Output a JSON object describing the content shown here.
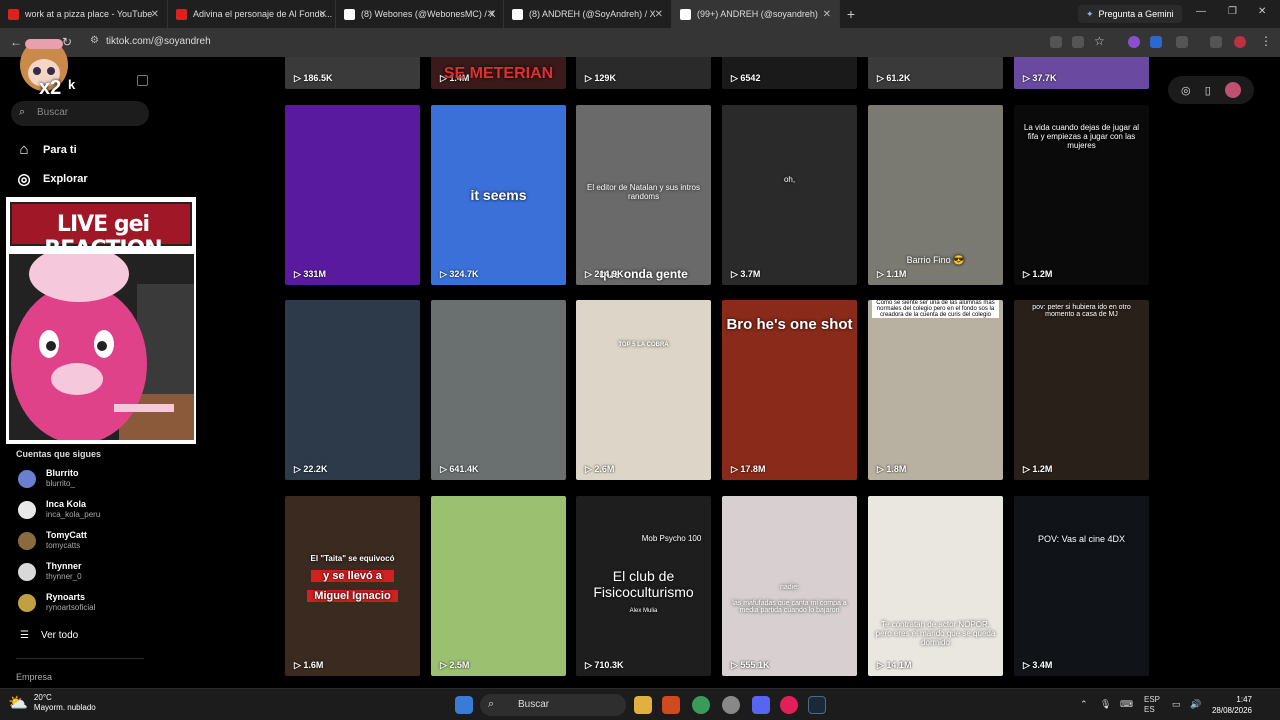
{
  "browser": {
    "tabs": [
      {
        "title": "work at a pizza place - YouTube",
        "icon": "youtube-icon",
        "color": "#e02020"
      },
      {
        "title": "Adivina el personaje de Al Fondo...",
        "icon": "youtube-icon",
        "color": "#e02020"
      },
      {
        "title": "(8) Webones (@WebonesMC) / X",
        "icon": "x-icon",
        "color": "#ffffff"
      },
      {
        "title": "(8) ANDREH (@SoyAndreh) / X",
        "icon": "x-icon",
        "color": "#ffffff"
      },
      {
        "title": "(99+) ANDREH (@soyandreh)",
        "icon": "tiktok-icon",
        "color": "#ffffff"
      }
    ],
    "gemini_label": "Pregunta a Gemini",
    "url": "tiktok.com/@soyandreh"
  },
  "sidebar": {
    "logo_text": "k",
    "search_placeholder": "Buscar",
    "nav": [
      {
        "label": "Para ti",
        "icon": "home-icon"
      },
      {
        "label": "Explorar",
        "icon": "compass-icon"
      }
    ],
    "overlay": {
      "label": "x2"
    },
    "live_banner": "LIVE gei REACTION",
    "following_title": "Cuentas que sigues",
    "accounts": [
      {
        "name": "Blurrito",
        "handle": "blurrito_",
        "color": "#6a7fd0"
      },
      {
        "name": "Inca Kola",
        "handle": "inca_kola_peru",
        "color": "#e8e8e8"
      },
      {
        "name": "TomyCatt",
        "handle": "tomycatts",
        "color": "#8a6b3d"
      },
      {
        "name": "Thynner",
        "handle": "thynner_0",
        "color": "#d8d8d8"
      },
      {
        "name": "Rynoarts",
        "handle": "rynoartsoficial",
        "color": "#c0a040"
      }
    ],
    "see_all": "Ver todo",
    "company": "Empresa"
  },
  "videos": {
    "top_row": [
      "186.5K",
      "1.4M",
      "129K",
      "6542",
      "61.2K",
      "37.7K"
    ],
    "top_row_caption": "SE METERIAN",
    "rows": [
      [
        {
          "views": "331M",
          "caption": "",
          "bg": "#5a1aa0"
        },
        {
          "views": "324.7K",
          "caption": "it seems",
          "bg": "#3a70d8"
        },
        {
          "views": "214.9K",
          "caption": "El editor de Natalan y sus intros randoms",
          "caption2": "que onda gente",
          "bg": "#6a6a6a"
        },
        {
          "views": "3.7M",
          "caption": "oh,",
          "bg": "#2a2a2a"
        },
        {
          "views": "1.1M",
          "caption": "Barrio Fino 😎",
          "bg": "#7a7a72"
        },
        {
          "views": "1.2M",
          "caption": "La vida cuando dejas de jugar al fifa y empiezas a jugar con las mujeres",
          "bg": "#0a0a0a"
        }
      ],
      [
        {
          "views": "22.2K",
          "caption": "",
          "bg": "#2c3a4a"
        },
        {
          "views": "641.4K",
          "caption": "",
          "bg": "#6a7070"
        },
        {
          "views": "2.6M",
          "caption": "TOP 5 LA COBRA",
          "bg": "#ddd6c8"
        },
        {
          "views": "17.8M",
          "caption": "Bro he's one shot",
          "bg": "#8a2a1a"
        },
        {
          "views": "1.8M",
          "caption": "Como se siente ser una de las alumnas mas normales del colegio pero en el fondo sos la creadora de la cuenta de curis del colegio",
          "bg": "#b8b0a0"
        },
        {
          "views": "1.2M",
          "caption": "pov: peter si hubiera ido en otro momento a casa de MJ",
          "bg": "#2a201a"
        }
      ],
      [
        {
          "views": "1.6M",
          "caption": "El \"Taita\" se equivocó",
          "caption2": "y se llevó a",
          "caption3": "Miguel Ignacio",
          "bg": "#3a2a20"
        },
        {
          "views": "2.5M",
          "caption": "",
          "bg": "#9ac070"
        },
        {
          "views": "710.3K",
          "caption": "El club de Fisicoculturismo",
          "caption2": "Mob Psycho 100",
          "caption3": "Alex Mulia",
          "bg": "#1e1e1e"
        },
        {
          "views": "555.1K",
          "caption": "nadie:",
          "caption2": "las mafufadas que canta mi compa a media partida cuando lo bajaron",
          "bg": "#d8d0d0"
        },
        {
          "views": "14.1M",
          "caption": "Te contratan de actor NOPOR, pero eres el marido que se queda dormido",
          "bg": "#eae6e0"
        },
        {
          "views": "3.4M",
          "caption": "POV: Vas al cine 4DX",
          "bg": "#101418"
        }
      ]
    ]
  },
  "taskbar": {
    "temp": "20°C",
    "weather": "Mayorm. nublado",
    "search": "Buscar",
    "lang1": "ESP",
    "lang2": "ES",
    "time": "1:47",
    "date": "28/08/2026"
  }
}
